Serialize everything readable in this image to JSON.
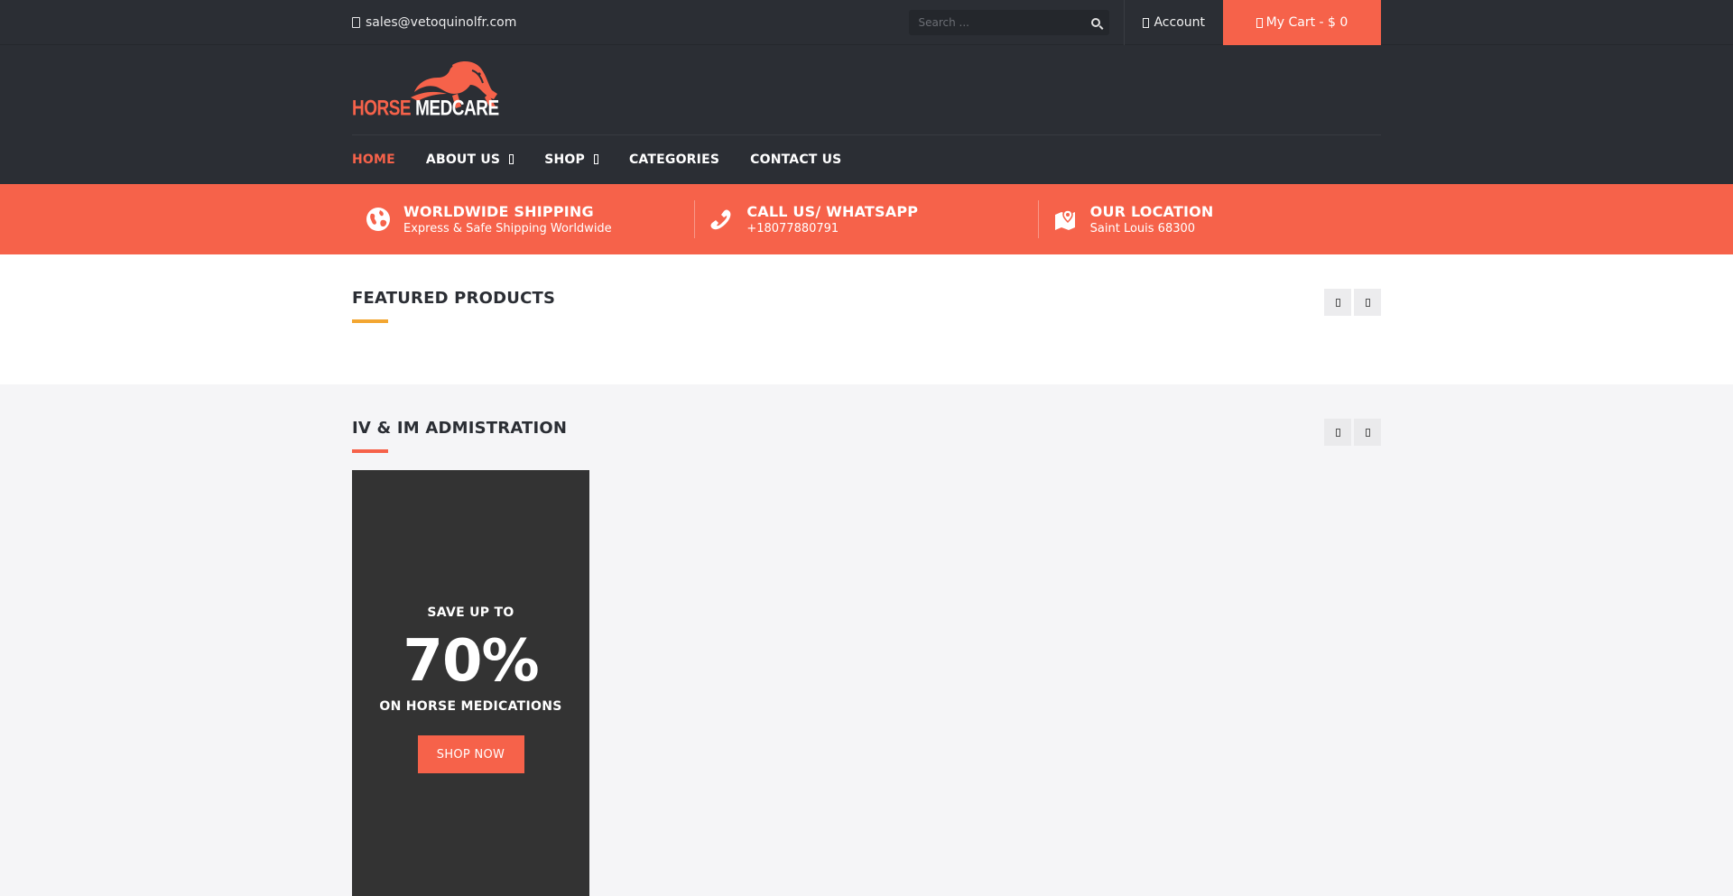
{
  "topbar": {
    "email": "sales@vetoquinolfr.com",
    "search_placeholder": "Search ...",
    "account_label": "Account",
    "cart_label": "My Cart - $ 0"
  },
  "header": {
    "logo_text_1": "HORSE",
    "logo_text_2": "MEDCARE"
  },
  "nav": {
    "home": "HOME",
    "about": "ABOUT US",
    "shop": "SHOP",
    "categories": "CATEGORIES",
    "contact": "CONTACT US"
  },
  "features": [
    {
      "title": "WORLDWIDE SHIPPING",
      "sub": "Express & Safe Shipping Worldwide",
      "icon": "globe-icon"
    },
    {
      "title": "CALL US/ WHATSAPP",
      "sub": "+18077880791",
      "icon": "phone-icon"
    },
    {
      "title": "OUR LOCATION",
      "sub": "Saint Louis 68300",
      "icon": "map-marker-icon"
    }
  ],
  "sections": {
    "featured_title": "FEATURED PRODUCTS",
    "iv_title": "IV & IM ADMISTRATION"
  },
  "promo": {
    "line1": "SAVE UP TO",
    "percent": "70%",
    "line2": "ON HORSE MEDICATIONS",
    "button": "SHOP NOW"
  },
  "colors": {
    "accent": "#f6624a",
    "dark": "#2b2e34",
    "yellow_underline": "#f3a631"
  }
}
